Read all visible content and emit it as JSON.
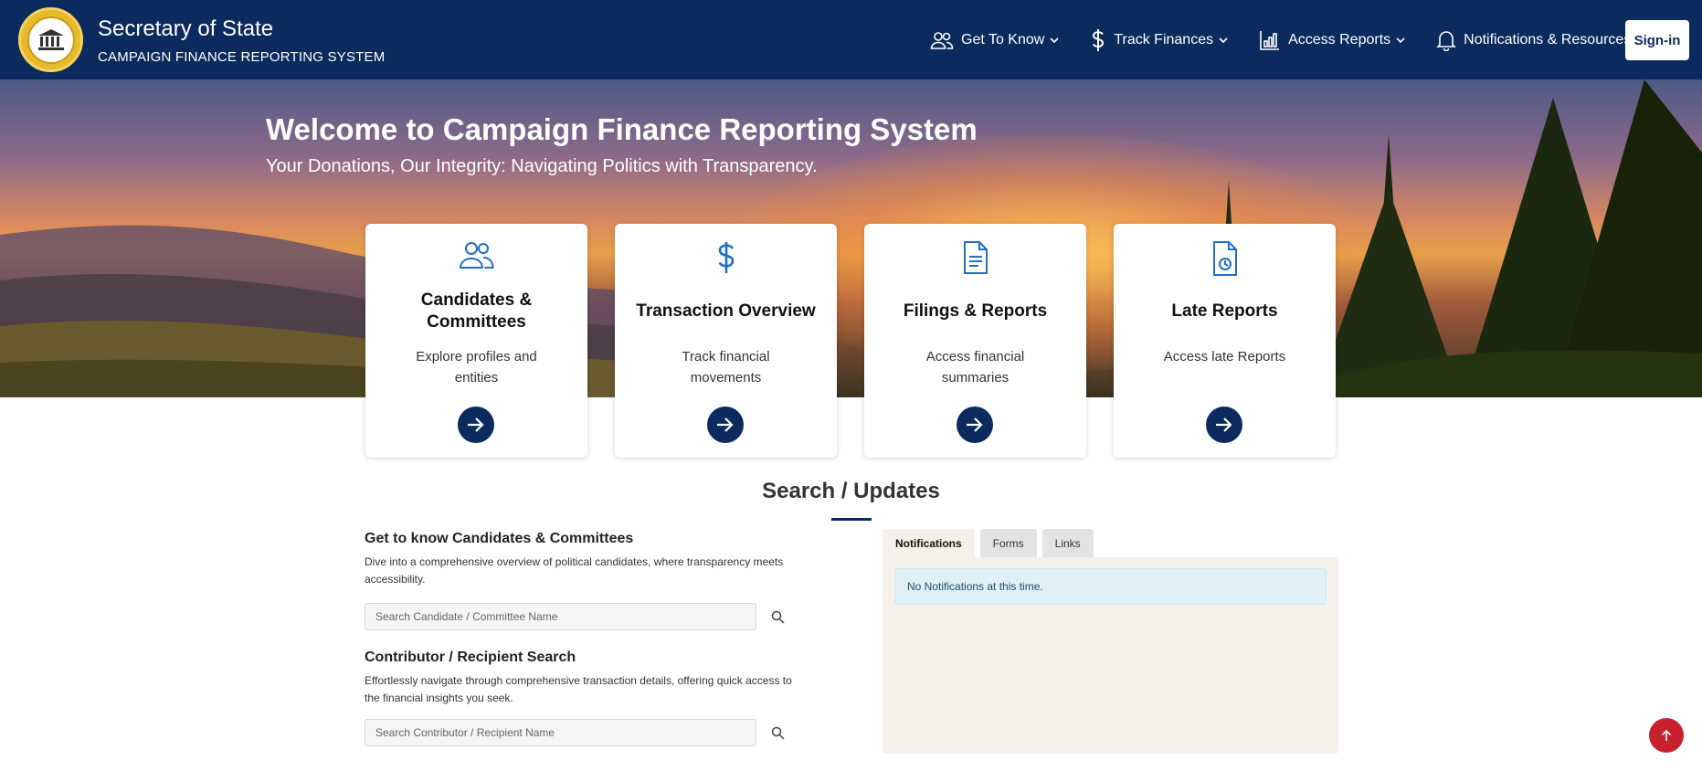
{
  "header": {
    "title": "Secretary of State",
    "subtitle": "CAMPAIGN FINANCE REPORTING SYSTEM",
    "nav": [
      {
        "label": "Get To Know",
        "icon": "people-icon"
      },
      {
        "label": "Track Finances",
        "icon": "dollar-icon"
      },
      {
        "label": "Access Reports",
        "icon": "bar-chart-icon"
      },
      {
        "label": "Notifications & Resources",
        "icon": "bell-icon"
      }
    ],
    "signin_label": "Sign-in"
  },
  "hero": {
    "title": "Welcome to Campaign Finance Reporting System",
    "subtitle": "Your Donations, Our Integrity: Navigating Politics with Transparency."
  },
  "cards": [
    {
      "title": "Candidates & Committees",
      "desc": "Explore profiles and entities",
      "icon": "people-icon"
    },
    {
      "title": "Transaction Overview",
      "desc": "Track financial movements",
      "icon": "dollar-icon"
    },
    {
      "title": "Filings & Reports",
      "desc": "Access financial summaries",
      "icon": "document-icon"
    },
    {
      "title": "Late Reports",
      "desc": "Access late Reports",
      "icon": "document-clock-icon"
    }
  ],
  "section": {
    "title": "Search / Updates"
  },
  "search": {
    "candidates": {
      "title": "Get to know Candidates & Committees",
      "desc": "Dive into a comprehensive overview of political candidates, where transparency meets accessibility.",
      "placeholder": "Search Candidate / Committee Name"
    },
    "contributors": {
      "title": "Contributor / Recipient Search",
      "desc": "Effortlessly navigate through comprehensive transaction details, offering quick access to the financial insights you seek.",
      "placeholder": "Search Contributor / Recipient Name"
    }
  },
  "tabs": {
    "items": [
      "Notifications",
      "Forms",
      "Links"
    ],
    "active": "Notifications",
    "notice": "No Notifications at this time."
  },
  "colors": {
    "navy": "#0b2a5e",
    "accent_red": "#c8202f",
    "gold": "#e7b92b"
  }
}
